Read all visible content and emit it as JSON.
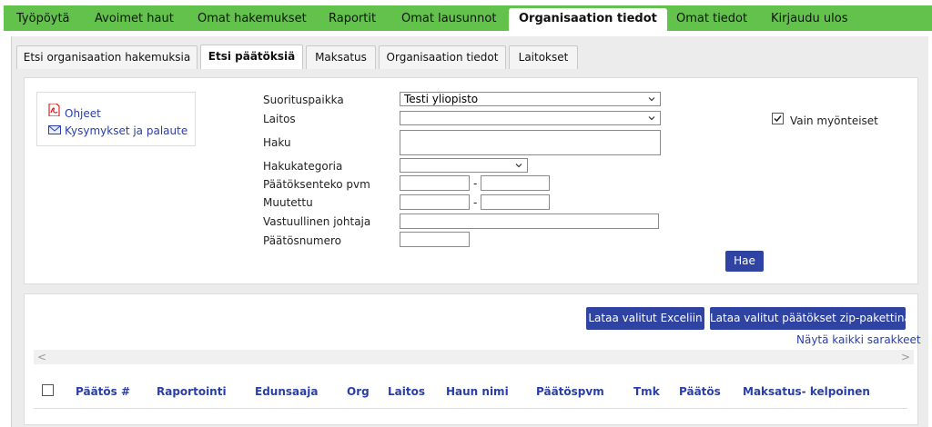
{
  "topnav": {
    "items": [
      "Työpöytä",
      "Avoimet haut",
      "Omat hakemukset",
      "Raportit",
      "Omat lausunnot",
      "Organisaation tiedot",
      "Omat tiedot",
      "Kirjaudu ulos"
    ],
    "active_index": 5
  },
  "subtabs": {
    "items": [
      "Etsi organisaation hakemuksia",
      "Etsi päätöksiä",
      "Maksatus",
      "Organisaation tiedot",
      "Laitokset"
    ],
    "active_index": 1
  },
  "help": {
    "instructions": "Ohjeet",
    "feedback": "Kysymykset ja palaute"
  },
  "form": {
    "suorituspaikka_label": "Suorituspaikka",
    "suorituspaikka_value": "Testi yliopisto",
    "laitos_label": "Laitos",
    "laitos_value": "",
    "haku_label": "Haku",
    "hakukategoria_label": "Hakukategoria",
    "hakukategoria_value": "",
    "paatoksenteko_label": "Päätöksenteko pvm",
    "muutettu_label": "Muutettu",
    "johtaja_label": "Vastuullinen johtaja",
    "paatosnumero_label": "Päätösnumero",
    "range_sep": "-",
    "only_approved_label": "Vain myönteiset",
    "only_approved_checked": true,
    "search_button": "Hae"
  },
  "results": {
    "export_excel": "Lataa valitut Exceliin",
    "export_zip": "Lataa valitut päätökset zip-pakettina",
    "show_all_columns": "Näytä kaikki sarakkeet",
    "scroll_left": "<",
    "scroll_right": ">",
    "columns": [
      "Päätös #",
      "Raportointi",
      "Edunsaaja",
      "Org",
      "Laitos",
      "Haun nimi",
      "Päätöspvm",
      "Tmk",
      "Päätös",
      "Maksatus- kelpoinen"
    ]
  },
  "colors": {
    "nav_green": "#62c24c",
    "button_blue": "#2f43a3",
    "link_blue": "#2a3ea8"
  }
}
